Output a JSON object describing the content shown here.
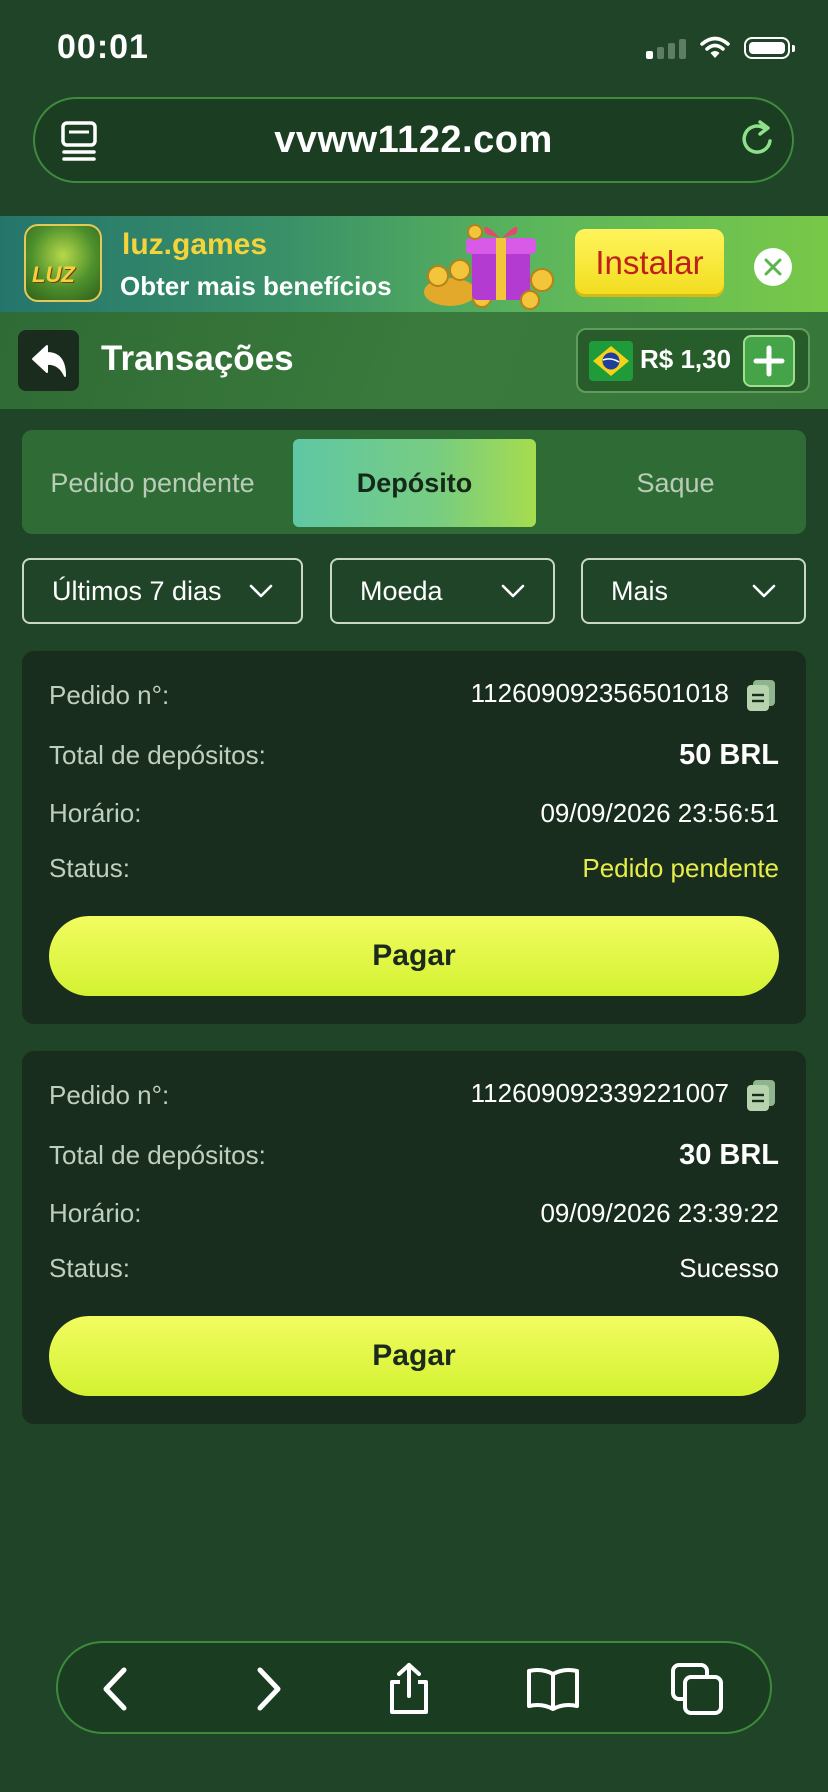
{
  "status_bar": {
    "time": "00:01"
  },
  "browser": {
    "url": "vvww1122.com"
  },
  "banner": {
    "logo_text": "LUZ",
    "title": "luz.games",
    "subtitle": "Obter mais benefícios",
    "install_label": "Instalar"
  },
  "header": {
    "title": "Transações",
    "balance": "R$ 1,30"
  },
  "tabs": [
    {
      "label": "Pedido pendente",
      "active": false
    },
    {
      "label": "Depósito",
      "active": true
    },
    {
      "label": "Saque",
      "active": false
    }
  ],
  "filters": [
    {
      "label": "Últimos 7 dias"
    },
    {
      "label": "Moeda"
    },
    {
      "label": "Mais"
    }
  ],
  "labels": {
    "order": "Pedido n°:",
    "total": "Total de depósitos:",
    "time": "Horário:",
    "status": "Status:"
  },
  "transactions": [
    {
      "order_no": "112609092356501018",
      "total": "50 BRL",
      "time": "09/09/2026 23:56:51",
      "status": "Pedido pendente",
      "button": "Pagar"
    },
    {
      "order_no": "112609092339221007",
      "total": "30 BRL",
      "time": "09/09/2026 23:39:22",
      "status": "Sucesso",
      "button": "Pagar"
    }
  ],
  "colors": {
    "background": "#1f4427",
    "card": "#182d1d",
    "accent": "#e6f84a",
    "pending_status": "#e6ec4a"
  },
  "icons": {
    "url_left": "reader-icon",
    "url_right": "reload-icon",
    "toolbar": [
      "back-icon",
      "forward-icon",
      "share-icon",
      "bookmarks-icon",
      "tabs-icon"
    ]
  }
}
